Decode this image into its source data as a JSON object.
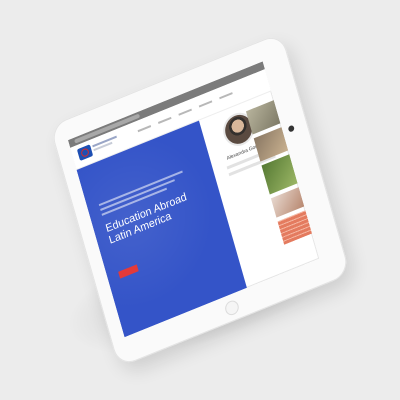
{
  "hero": {
    "title_line1": "Education Abroad",
    "title_line2": "Latin America"
  },
  "profile": {
    "name": "Alexandra Gonzales"
  },
  "colors": {
    "hero_bg": "#3454c8",
    "accent": "#e33a3a",
    "browser_bar": "#7b7b7b"
  },
  "icons": [
    "logo-icon",
    "camera-icon",
    "home-button-icon"
  ]
}
